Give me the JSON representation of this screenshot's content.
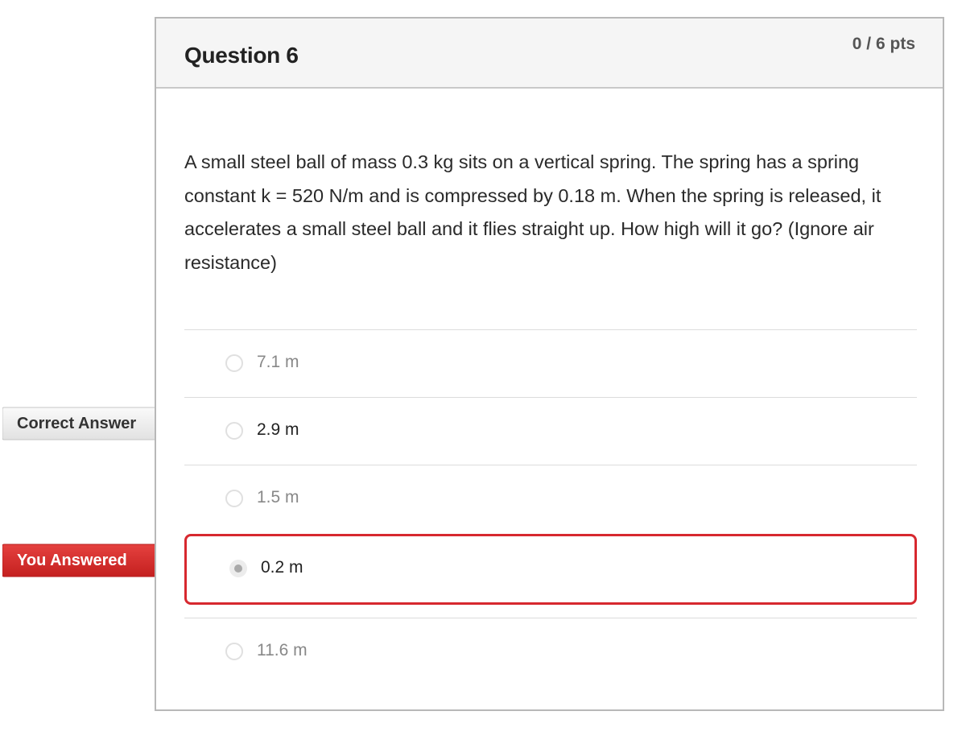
{
  "question": {
    "title": "Question 6",
    "points": "0 / 6 pts",
    "text": "A small steel ball of mass 0.3 kg sits on a vertical spring. The spring has a spring constant k = 520 N/m and is compressed by 0.18 m. When the spring is released, it accelerates a small steel ball and it flies straight up. How high will it go? (Ignore air resistance)"
  },
  "answers": [
    {
      "label": "7.1 m",
      "state": "unselected"
    },
    {
      "label": "2.9 m",
      "state": "correct"
    },
    {
      "label": "1.5 m",
      "state": "unselected"
    },
    {
      "label": "0.2 m",
      "state": "selected-incorrect"
    },
    {
      "label": "11.6 m",
      "state": "unselected"
    }
  ],
  "flags": {
    "correct_answer": "Correct Answer",
    "you_answered": "You Answered"
  },
  "colors": {
    "incorrect_red": "#d7282f",
    "header_bg": "#f5f5f5"
  }
}
